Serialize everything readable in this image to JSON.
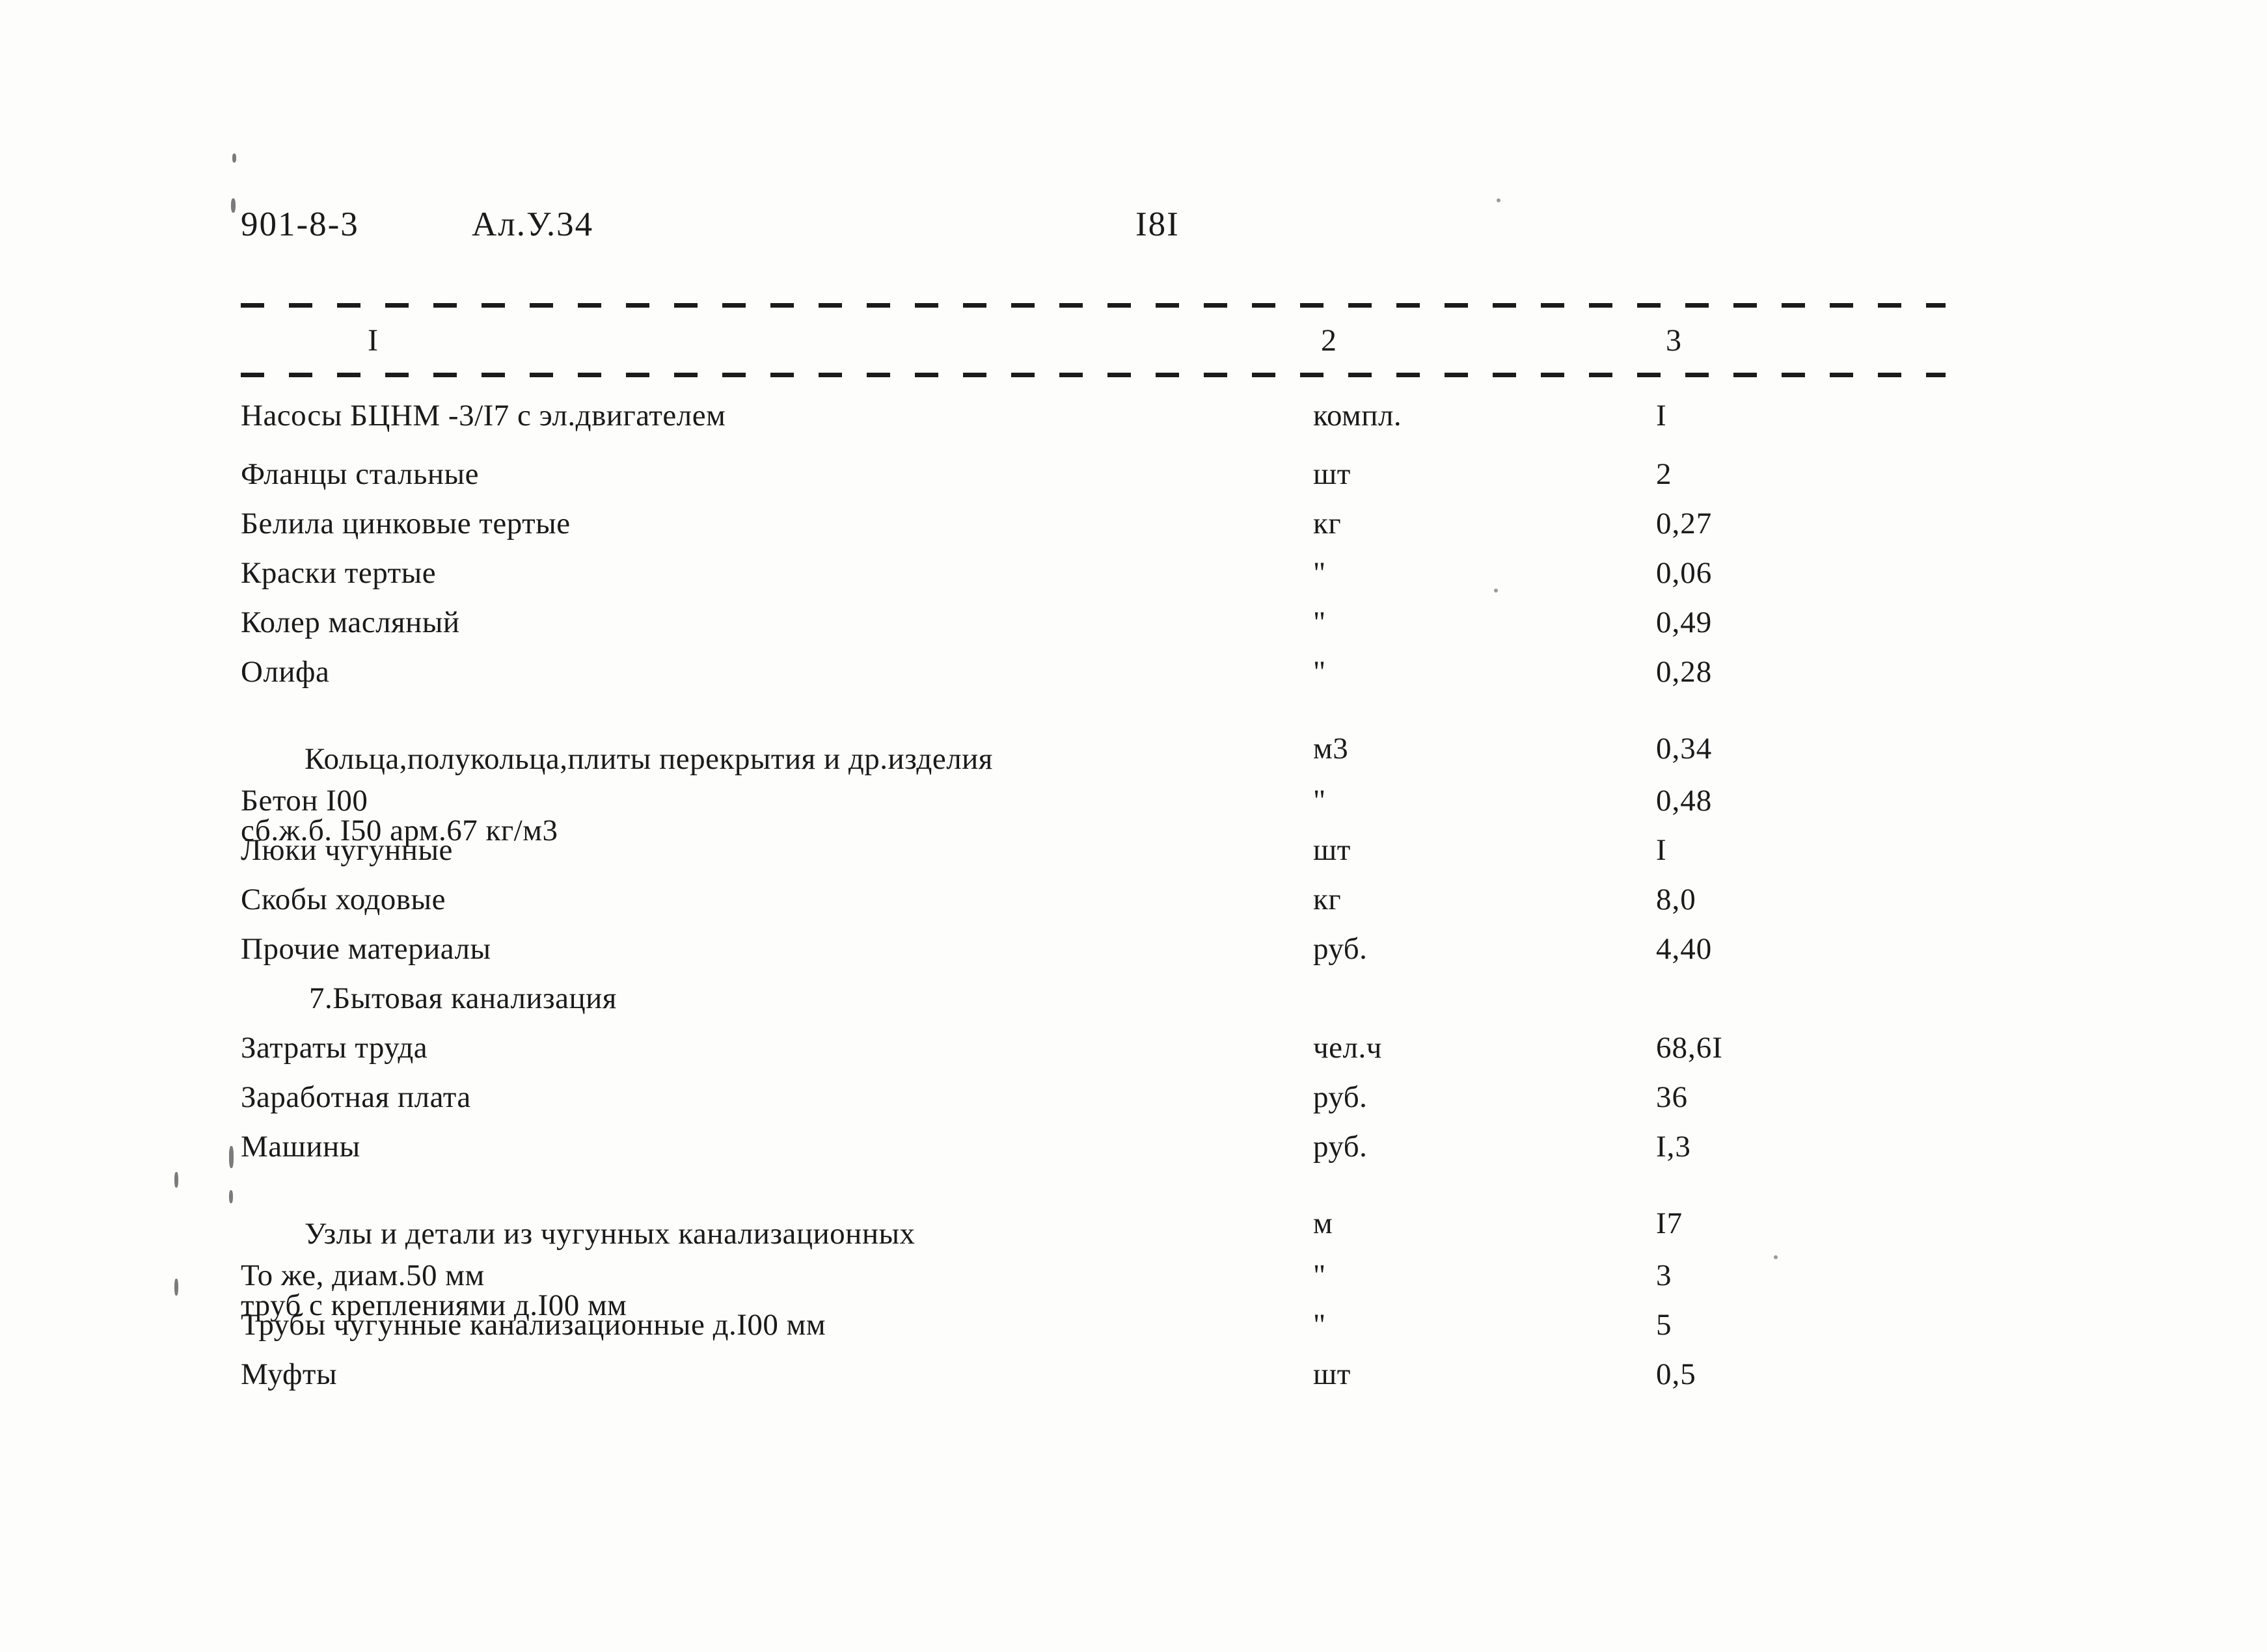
{
  "header": {
    "doc_code": "901-8-3",
    "album": "Ал.У.34",
    "page_number": "I8I"
  },
  "table": {
    "column_headers": [
      "I",
      "2",
      "3"
    ],
    "rows": [
      {
        "name": "Насосы БЦНМ -3/I7 с эл.двигателем",
        "name2": "",
        "unit": "компл.",
        "qty": "I"
      },
      {
        "name": "Фланцы стальные",
        "name2": "",
        "unit": "шт",
        "qty": "2"
      },
      {
        "name": "Белила цинковые тертые",
        "name2": "",
        "unit": "кг",
        "qty": "0,27"
      },
      {
        "name": "Краски тертые",
        "name2": "",
        "unit": "\"",
        "qty": "0,06"
      },
      {
        "name": "Колер масляный",
        "name2": "",
        "unit": "\"",
        "qty": "0,49"
      },
      {
        "name": "Олифа",
        "name2": "",
        "unit": "\"",
        "qty": "0,28"
      },
      {
        "name": "Кольца,полукольца,плиты перекрытия и др.изделия",
        "name2": "сб.ж.б. I50 арм.67 кг/м3",
        "unit": "м3",
        "qty": "0,34"
      },
      {
        "name": "Бетон I00",
        "name2": "",
        "unit": "\"",
        "qty": "0,48"
      },
      {
        "name": "Люки чугунные",
        "name2": "",
        "unit": "шт",
        "qty": "I"
      },
      {
        "name": "Скобы ходовые",
        "name2": "",
        "unit": "кг",
        "qty": "8,0"
      },
      {
        "name": "Прочие материалы",
        "name2": "",
        "unit": "руб.",
        "qty": "4,40"
      },
      {
        "name": "7.Бытовая канализация",
        "name2": "",
        "unit": "",
        "qty": ""
      },
      {
        "name": "Затраты труда",
        "name2": "",
        "unit": "чел.ч",
        "qty": "68,6I"
      },
      {
        "name": "Заработная плата",
        "name2": "",
        "unit": "руб.",
        "qty": "36"
      },
      {
        "name": "Машины",
        "name2": "",
        "unit": "руб.",
        "qty": "I,3"
      },
      {
        "name": "Узлы и детали из чугунных канализационных",
        "name2": "труб с креплениями д.I00 мм",
        "unit": "м",
        "qty": "I7"
      },
      {
        "name": "То же, диам.50 мм",
        "name2": "",
        "unit": "\"",
        "qty": "3"
      },
      {
        "name": "Трубы чугунные канализационные д.I00 мм",
        "name2": "",
        "unit": "\"",
        "qty": "5"
      },
      {
        "name": "Муфты",
        "name2": "",
        "unit": "шт",
        "qty": "0,5"
      }
    ]
  }
}
